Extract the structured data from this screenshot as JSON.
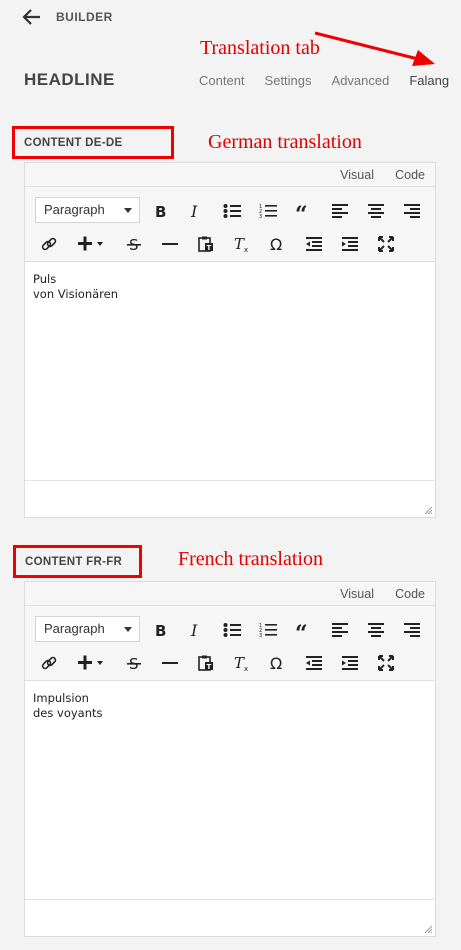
{
  "header": {
    "back_label": "BUILDER",
    "title": "HEADLINE",
    "tabs": [
      {
        "label": "Content"
      },
      {
        "label": "Settings"
      },
      {
        "label": "Advanced"
      },
      {
        "label": "Falang"
      }
    ]
  },
  "annotations": {
    "tab_note": "Translation tab",
    "german_note": "German translation",
    "french_note": "French translation",
    "color": "#e20000"
  },
  "editor_common": {
    "mode_visual": "Visual",
    "mode_code": "Code",
    "format_selected": "Paragraph",
    "icons_row1": [
      "bold-icon",
      "italic-icon",
      "bullet-list-icon",
      "numbered-list-icon",
      "blockquote-icon",
      "align-left-icon",
      "align-center-icon",
      "align-right-icon"
    ],
    "icons_row2": [
      "link-icon",
      "insert-plus-icon",
      "strikethrough-icon",
      "horizontal-rule-icon",
      "paste-text-icon",
      "clear-format-icon",
      "omega-icon",
      "outdent-icon",
      "indent-icon",
      "fullscreen-icon"
    ]
  },
  "sections": [
    {
      "label": "CONTENT DE-DE",
      "content_lines": [
        "Puls",
        "von Visionären"
      ]
    },
    {
      "label": "CONTENT FR-FR",
      "content_lines": [
        "Impulsion",
        "des voyants"
      ]
    }
  ]
}
